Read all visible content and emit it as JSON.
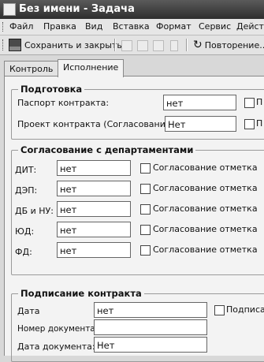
{
  "window": {
    "title": "Без имени - Задача"
  },
  "menu": [
    "Файл",
    "Правка",
    "Вид",
    "Вставка",
    "Формат",
    "Сервис",
    "Действ"
  ],
  "toolbar": {
    "save_close": "Сохранить и закрыть",
    "repeat": "Повторение..."
  },
  "tabs": [
    "Контроль",
    "Исполнение"
  ],
  "prep": {
    "title": "Подготовка",
    "passport_label": "Паспорт контракта:",
    "passport_value": "нет",
    "passport_cb": "П",
    "draft_label": "Проект контракта (Согласование):",
    "draft_value": "Нет",
    "draft_cb": "П"
  },
  "dept": {
    "title": "Согласование с департаментами",
    "rows": [
      {
        "label": "ДИТ:",
        "value": "нет",
        "cb": "Согласование отметка"
      },
      {
        "label": "ДЭП:",
        "value": "нет",
        "cb": "Согласование отметка"
      },
      {
        "label": "ДБ и НУ:",
        "value": "нет",
        "cb": "Согласование отметка"
      },
      {
        "label": "ЮД:",
        "value": "нет",
        "cb": "Согласование отметка"
      },
      {
        "label": "ФД:",
        "value": "нет",
        "cb": "Согласование отметка"
      }
    ]
  },
  "sign": {
    "title": "Подписание контракта",
    "date_label": "Дата",
    "date_value": "нет",
    "date_cb": "Подписан",
    "docnum_label": "Номер документа:",
    "docnum_value": "",
    "docdate_label": "Дата документа:",
    "docdate_value": "Нет"
  }
}
